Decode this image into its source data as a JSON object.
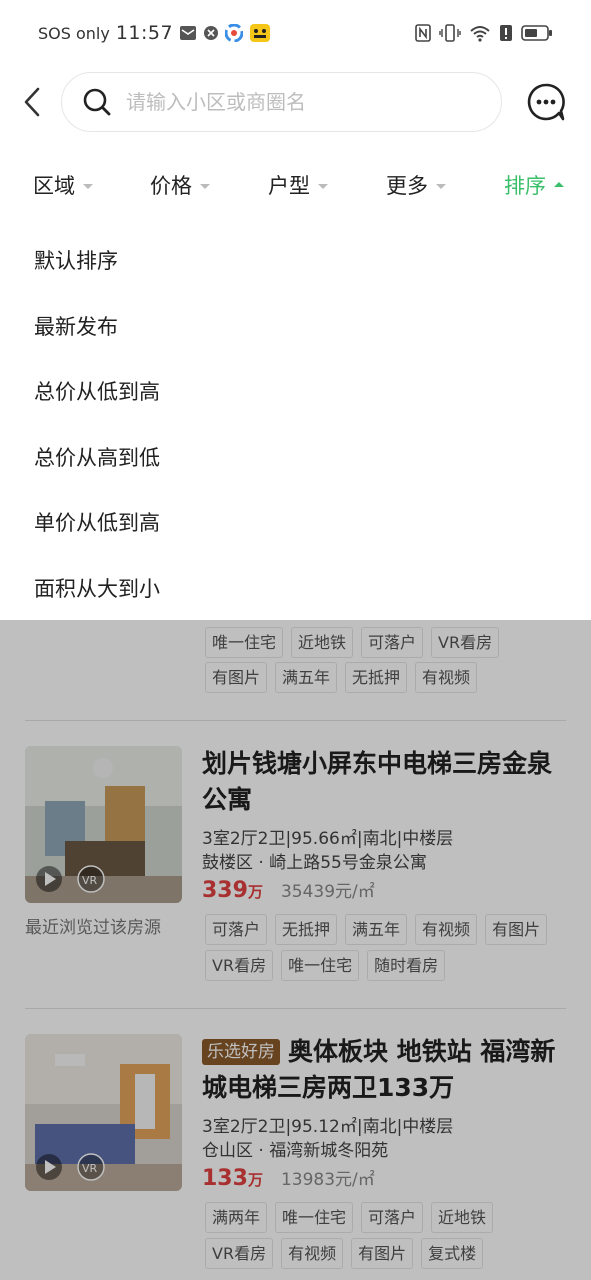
{
  "status": {
    "carrier": "SOS only",
    "time": "11:57",
    "battery_icon": "battery-icon",
    "accent": "#3bbf6a"
  },
  "search": {
    "placeholder": "请输入小区或商圈名"
  },
  "filters": [
    {
      "label": "区域"
    },
    {
      "label": "价格"
    },
    {
      "label": "户型"
    },
    {
      "label": "更多"
    },
    {
      "label": "排序",
      "active": true
    }
  ],
  "sort_options": [
    "默认排序",
    "最新发布",
    "总价从低到高",
    "总价从高到低",
    "单价从低到高",
    "面积从大到小"
  ],
  "listings": [
    {
      "tags_row1": [
        "唯一住宅",
        "近地铁",
        "可落户",
        "VR看房"
      ],
      "tags_row2": [
        "有图片",
        "满五年",
        "无抵押",
        "有视频"
      ]
    },
    {
      "title": "划片钱塘小屏东中电梯三房金泉公寓",
      "meta": "3室2厅2卫|95.66㎡|南北|中楼层",
      "location": "鼓楼区 · 崎上路55号金泉公寓",
      "price_total": "339",
      "price_unit": "万",
      "price_per": "35439元/㎡",
      "recent": "最近浏览过该房源",
      "tags_row1": [
        "可落户",
        "无抵押",
        "满五年",
        "有视频",
        "有图片"
      ],
      "tags_row2": [
        "VR看房",
        "唯一住宅",
        "随时看房"
      ]
    },
    {
      "badge": "乐选好房",
      "title": "奥体板块 地铁站 福湾新城电梯三房两卫133万",
      "meta": "3室2厅2卫|95.12㎡|南北|中楼层",
      "location": "仓山区 · 福湾新城冬阳苑",
      "price_total": "133",
      "price_unit": "万",
      "price_per": "13983元/㎡",
      "tags_row1": [
        "满两年",
        "唯一住宅",
        "可落户",
        "近地铁"
      ],
      "tags_row2": [
        "VR看房",
        "有视频",
        "有图片",
        "复式楼"
      ]
    }
  ]
}
